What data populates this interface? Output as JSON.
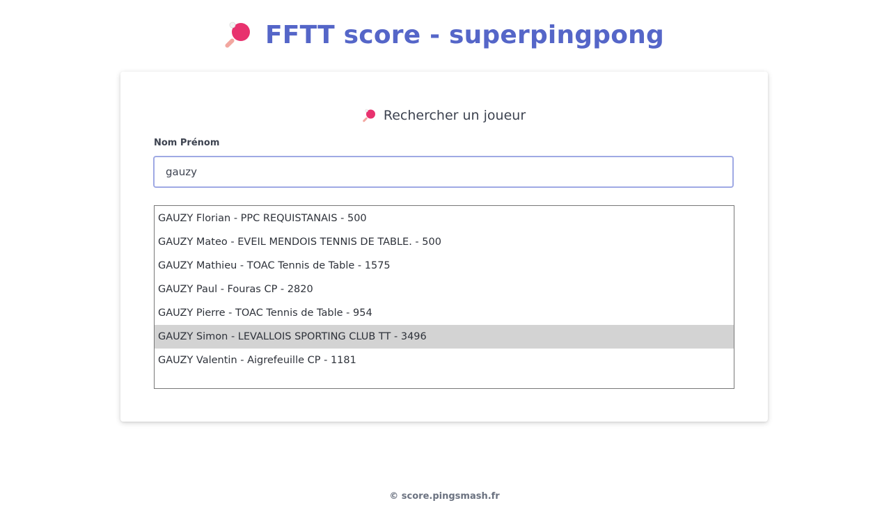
{
  "header": {
    "title": "FFTT score - superpingpong",
    "icon": "ping-pong-paddle-icon"
  },
  "search": {
    "heading": "Rechercher un joueur",
    "heading_icon": "ping-pong-paddle-icon",
    "label": "Nom Prénom",
    "value": "gauzy",
    "results": [
      "GAUZY Florian - PPC REQUISTANAIS - 500",
      "GAUZY Mateo - EVEIL MENDOIS TENNIS DE TABLE. - 500",
      "GAUZY Mathieu - TOAC Tennis de Table - 1575",
      "GAUZY Paul - Fouras CP - 2820",
      "GAUZY Pierre - TOAC Tennis de Table - 954",
      "GAUZY Simon - LEVALLOIS SPORTING CLUB TT - 3496",
      "GAUZY Valentin - Aigrefeuille CP - 1181"
    ],
    "selected_index": 5
  },
  "footer": {
    "text": "© score.pingsmash.fr"
  },
  "colors": {
    "title": "#5566c8",
    "paddle": "#e8326e",
    "input_border": "#9fa9e4",
    "selected_row": "#d3d3d3"
  }
}
